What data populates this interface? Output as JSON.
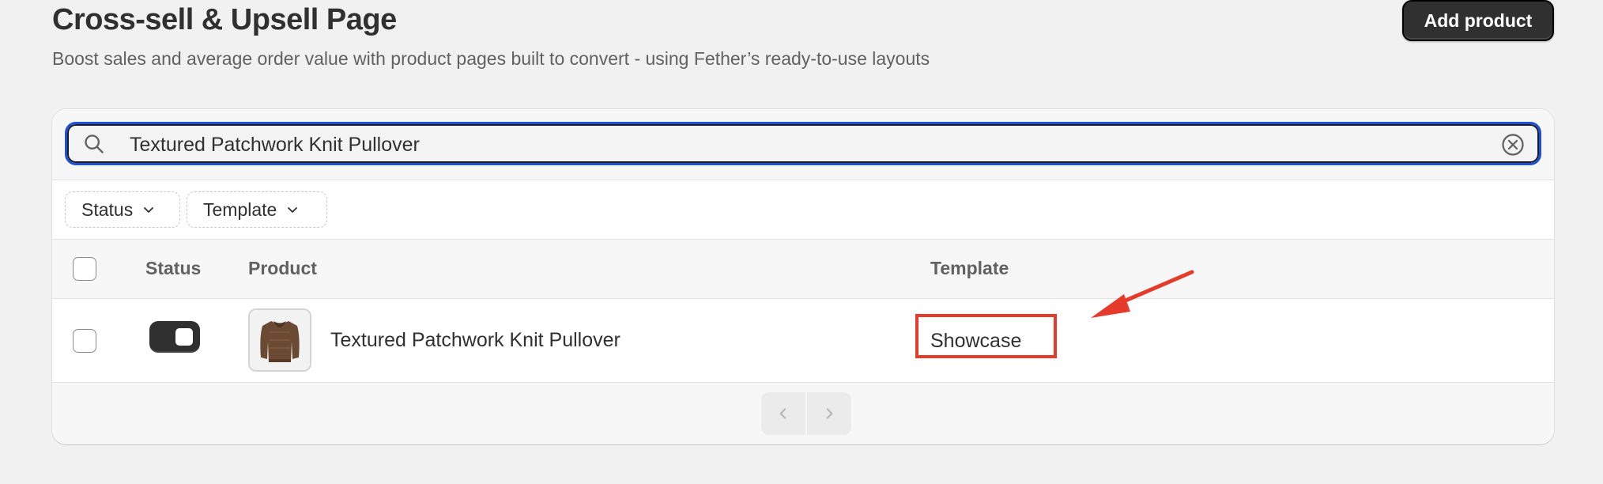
{
  "header": {
    "title": "Cross-sell & Upsell Page",
    "subtitle": "Boost sales and average order value with product pages built to convert - using Fether’s ready-to-use layouts",
    "add_product_label": "Add product"
  },
  "search": {
    "value": "Textured Patchwork Knit Pullover",
    "icon": "search-icon",
    "clear_icon": "clear-icon"
  },
  "filters": [
    {
      "label": "Status"
    },
    {
      "label": "Template"
    }
  ],
  "table": {
    "columns": [
      "Status",
      "Product",
      "Template"
    ],
    "rows": [
      {
        "status_enabled": true,
        "product": "Textured Patchwork Knit Pullover",
        "template": "Showcase"
      }
    ]
  },
  "pagination": {
    "prev_icon": "chevron-left-icon",
    "next_icon": "chevron-right-icon"
  },
  "colors": {
    "focus_ring": "#1d4fd8",
    "annotation": "#e63a2a",
    "primary_button": "#303030"
  }
}
